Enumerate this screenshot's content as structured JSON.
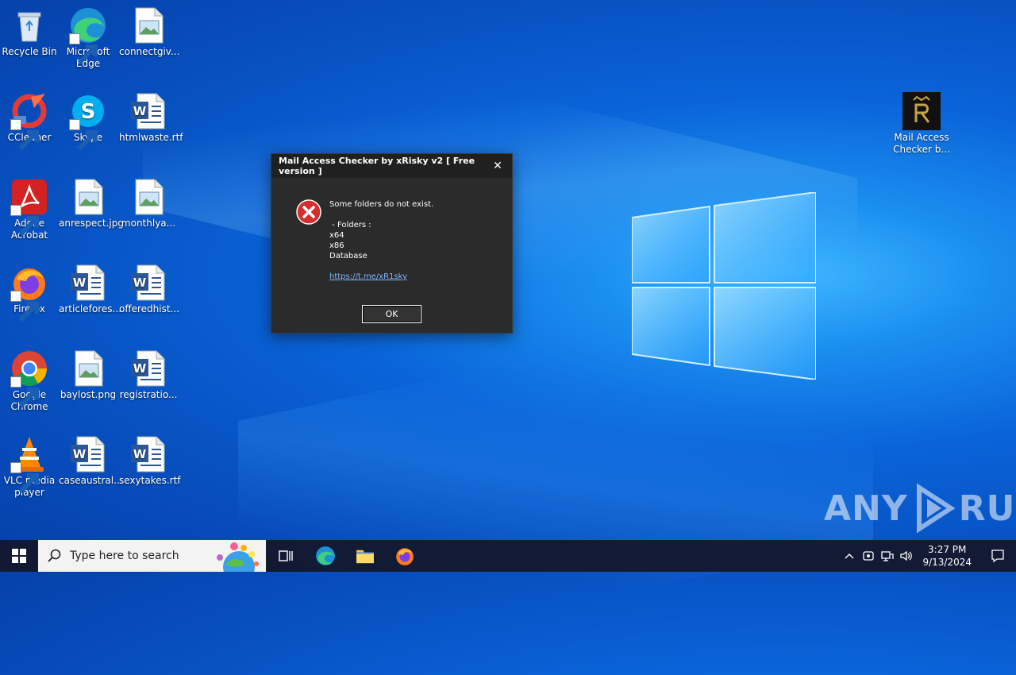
{
  "desktop": {
    "icons": [
      {
        "label": "Recycle Bin"
      },
      {
        "label": "Microsoft Edge"
      },
      {
        "label": "connectgiv..."
      },
      {
        "label": "CCleaner"
      },
      {
        "label": "Skype"
      },
      {
        "label": "htmlwaste.rtf"
      },
      {
        "label": "Adobe Acrobat"
      },
      {
        "label": "anrespect.jpg"
      },
      {
        "label": "monthlya..."
      },
      {
        "label": "Firefox"
      },
      {
        "label": "articlefores..."
      },
      {
        "label": "offeredhist..."
      },
      {
        "label": "Google Chrome"
      },
      {
        "label": "baylost.png"
      },
      {
        "label": "registratio..."
      },
      {
        "label": "VLC media player"
      },
      {
        "label": "caseaustral..."
      },
      {
        "label": "sexytakes.rtf"
      },
      {
        "label": "Mail Access Checker b..."
      }
    ]
  },
  "dialog": {
    "title": "Mail Access Checker by xRisky v2 [ Free version ]",
    "close_glyph": "✕",
    "lines": [
      "Some folders do not exist.",
      "",
      " - Folders :",
      "x64",
      "x86",
      "Database",
      ""
    ],
    "link": "https://t.me/xR1sky",
    "ok_label": "OK"
  },
  "watermark": {
    "left": "ANY",
    "right": "RUN"
  },
  "taskbar": {
    "search_placeholder": "Type here to search",
    "time": "3:27 PM",
    "date": "9/13/2024"
  },
  "colors": {
    "accent": "#0a64d8",
    "dialog_bg": "#2b2b2b",
    "link": "#7ab8ff",
    "error_red": "#d32f2f"
  }
}
